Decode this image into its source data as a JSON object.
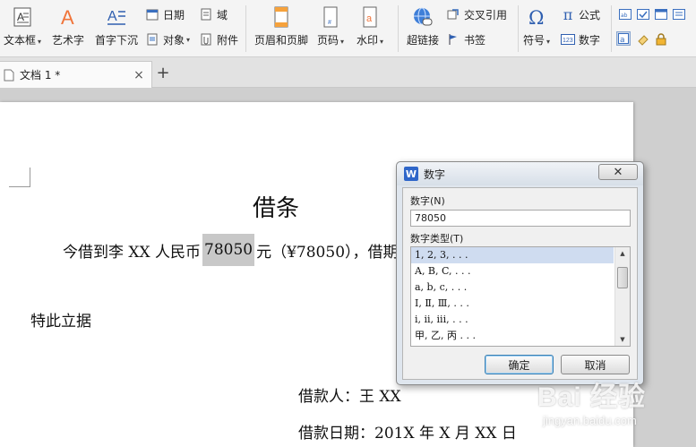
{
  "ribbon": {
    "textbox": "文本框",
    "wordart": "艺术字",
    "dropcap": "首字下沉",
    "date": "日期",
    "field": "域",
    "object": "对象",
    "attachment": "附件",
    "header_footer": "页眉和页脚",
    "page_number": "页码",
    "watermark": "水印",
    "hyperlink": "超链接",
    "crossref": "交叉引用",
    "bookmark": "书签",
    "symbol": "符号",
    "formula": "公式",
    "number": "数字",
    "icons": {
      "textbox": "text-box-icon",
      "wordart": "letter-a-icon",
      "dropcap": "drop-cap-icon",
      "hyperlink": "globe-link-icon",
      "symbol": "omega-icon",
      "formula": "pi-icon",
      "number": "123-icon"
    }
  },
  "tabs": {
    "doc_title": "文档 1 *",
    "close": "×",
    "new": "+"
  },
  "document": {
    "title": "借条",
    "line1_before": "今借到李 XX 人民币",
    "line1_amount": "78050",
    "line1_after": "元（¥78050），借期",
    "line2": "特此立据",
    "borrower": "借款人：王 XX",
    "date": "借款日期：201X 年 X 月 XX 日"
  },
  "dialog": {
    "logo": "W",
    "title": "数字",
    "close": "✕",
    "number_label": "数字(N)",
    "number_value": "78050",
    "type_label": "数字类型(T)",
    "types": [
      "1, 2, 3, . . .",
      "A, B, C, . . .",
      "a, b, c, . . .",
      "Ⅰ, Ⅱ, Ⅲ, . . .",
      "i, ii, iii, . . .",
      "甲, 乙, 丙 . . ."
    ],
    "selected_index": 0,
    "ok": "确定",
    "cancel": "取消"
  },
  "watermark": {
    "main": "Bai 经验",
    "sub": "jingyan.baidu.com"
  },
  "colors": {
    "ribbon_bg": "#f4f4f4",
    "accent_orange": "#f0743a",
    "accent_blue": "#2f66c9",
    "selection": "#cfdcf0",
    "highlight": "#c8c8c8"
  }
}
